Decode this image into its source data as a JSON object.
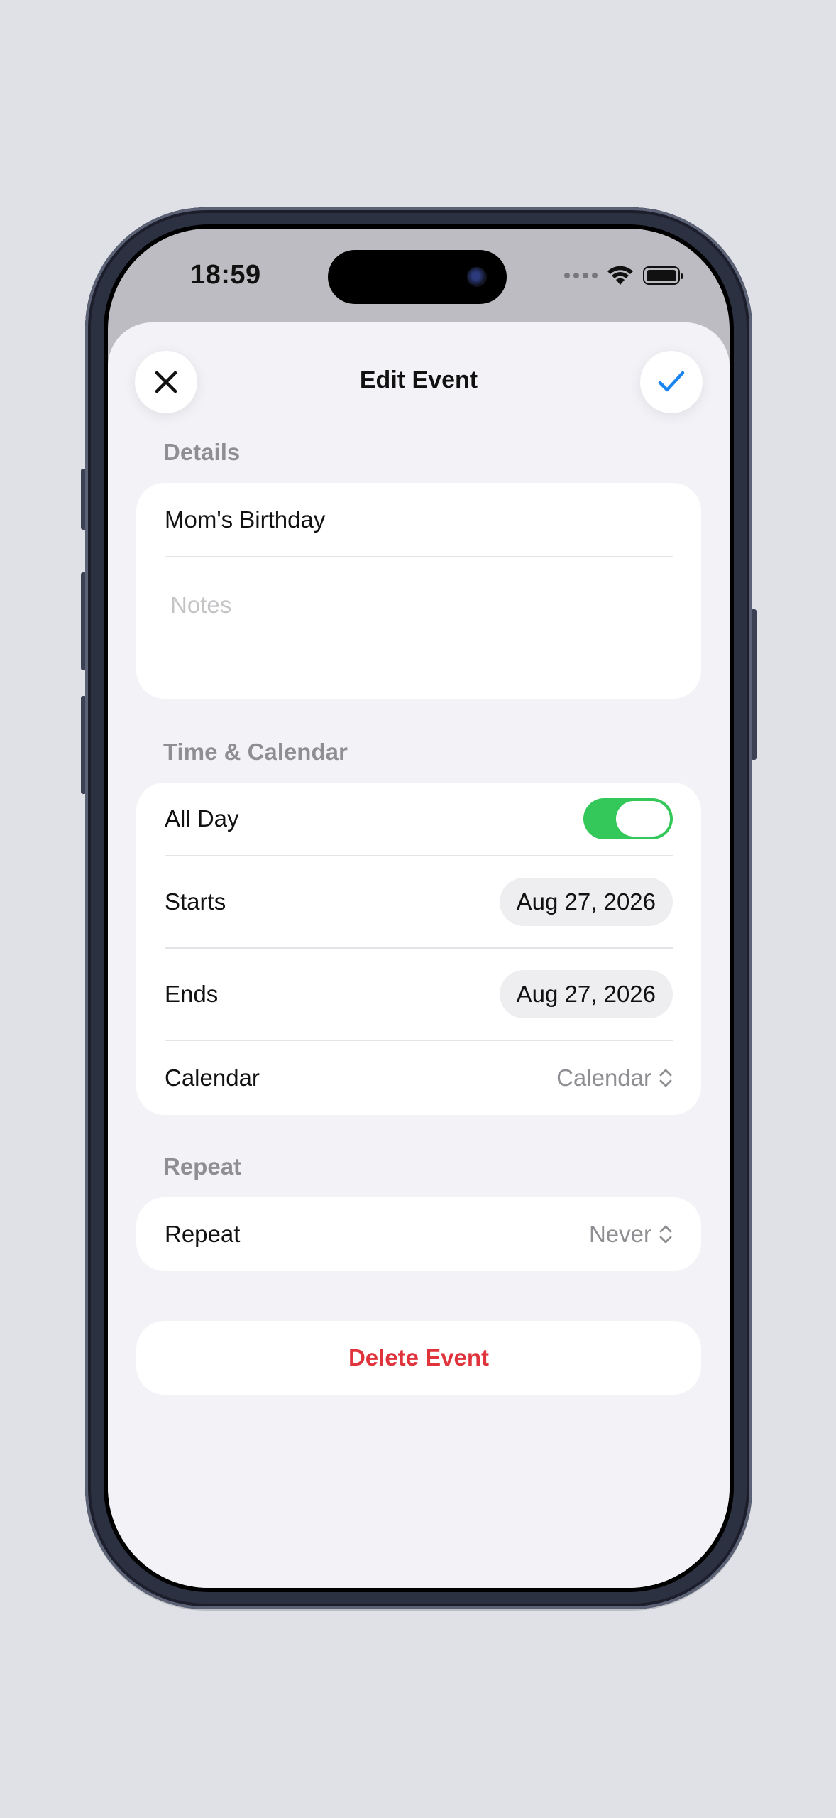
{
  "status_bar": {
    "time": "18:59"
  },
  "header": {
    "title": "Edit Event"
  },
  "details": {
    "section_label": "Details",
    "title_value": "Mom's Birthday",
    "notes_placeholder": "Notes"
  },
  "time_calendar": {
    "section_label": "Time & Calendar",
    "all_day_label": "All Day",
    "all_day_on": true,
    "starts_label": "Starts",
    "starts_value": "Aug 27, 2026",
    "ends_label": "Ends",
    "ends_value": "Aug 27, 2026",
    "calendar_label": "Calendar",
    "calendar_value": "Calendar"
  },
  "repeat": {
    "section_label": "Repeat",
    "repeat_label": "Repeat",
    "repeat_value": "Never"
  },
  "actions": {
    "delete_label": "Delete Event"
  },
  "colors": {
    "accent": "#1a84f0",
    "toggle_on": "#34c759",
    "destructive": "#e0343d",
    "background": "#f2f2f7"
  }
}
